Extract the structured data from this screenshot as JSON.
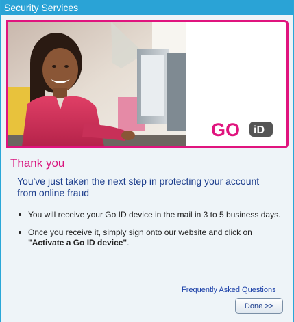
{
  "window": {
    "title": "Security Services"
  },
  "banner": {
    "photo_icon": "smiling-woman-at-computer-photo",
    "logo_text": "GO",
    "logo_badge": "iD",
    "logo_color": "#e0147e",
    "border_color": "#e0147e"
  },
  "content": {
    "heading": "Thank you",
    "lead": "You've just taken the next step in protecting your account from online fraud",
    "bullet1": "You will receive your Go ID device in the mail in 3 to 5 business days.",
    "bullet2_prefix": "Once you receive it, simply sign onto our website and click on ",
    "bullet2_link": "\"Activate a Go ID device\"",
    "bullet2_suffix": "."
  },
  "links": {
    "faq": "Frequently Asked Questions"
  },
  "buttons": {
    "done": "Done >>"
  },
  "colors": {
    "title_bar": "#2aa3d6",
    "heading": "#d9157e",
    "lead_text": "#1c3d8c"
  }
}
